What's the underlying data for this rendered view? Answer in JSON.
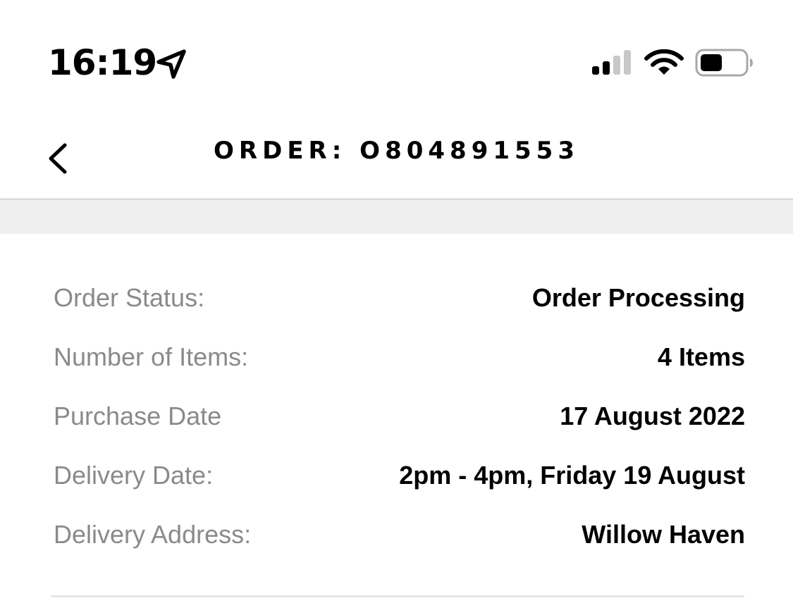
{
  "status_bar": {
    "time": "16:19",
    "location_icon": "location-arrow-icon",
    "signal_icon": "cellular-signal-icon",
    "wifi_icon": "wifi-icon",
    "battery_icon": "battery-icon",
    "signal_bars_active": 2,
    "signal_bars_total": 4,
    "battery_level": 0.4
  },
  "nav": {
    "back_icon": "chevron-left-icon",
    "title": "ORDER: O804891553"
  },
  "details": {
    "rows": [
      {
        "label": "Order Status:",
        "value": "Order Processing"
      },
      {
        "label": "Number of Items:",
        "value": "4 Items"
      },
      {
        "label": "Purchase Date",
        "value": "17 August 2022"
      },
      {
        "label": "Delivery Date:",
        "value": "2pm - 4pm, Friday 19 August"
      },
      {
        "label": "Delivery Address:",
        "value": "Willow Haven"
      }
    ]
  },
  "colors": {
    "label_gray": "#8a8a8a",
    "band_gray": "#efefef",
    "text": "#000000"
  }
}
